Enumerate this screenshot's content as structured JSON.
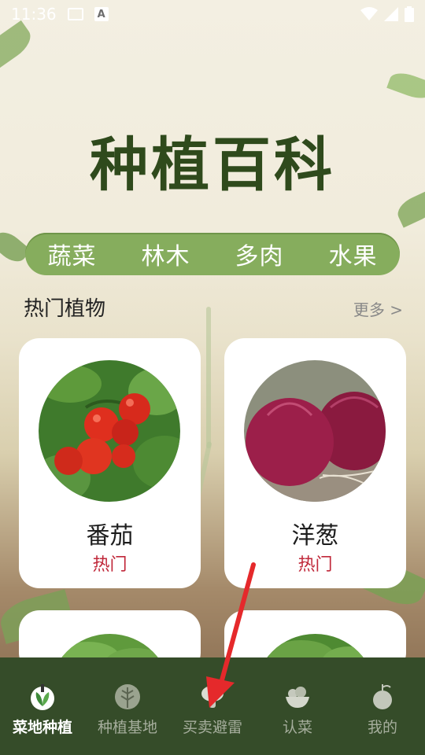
{
  "status_bar": {
    "time": "11:36",
    "a_badge": "A",
    "icons": [
      "image-icon",
      "a-icon",
      "wifi-icon",
      "signal-icon",
      "battery-icon"
    ]
  },
  "title": "种植百科",
  "categories": [
    "蔬菜",
    "林木",
    "多肉",
    "水果"
  ],
  "section": {
    "title": "热门植物",
    "more": "更多 >"
  },
  "plants": [
    {
      "name": "番茄",
      "tag": "热门"
    },
    {
      "name": "洋葱",
      "tag": "热门"
    }
  ],
  "nav": [
    {
      "label": "菜地种植",
      "icon": "garden-icon",
      "active": true
    },
    {
      "label": "种植基地",
      "icon": "tree-icon",
      "active": false
    },
    {
      "label": "买卖避雷",
      "icon": "mushroom-icon",
      "active": false
    },
    {
      "label": "认菜",
      "icon": "vegetable-bowl-icon",
      "active": false
    },
    {
      "label": "我的",
      "icon": "profile-icon",
      "active": false
    }
  ],
  "colors": {
    "title": "#2f4a1c",
    "pill": "#86ad5d",
    "tag": "#c0283a",
    "nav_bg": "#354c29",
    "arrow": "#e5292b"
  }
}
